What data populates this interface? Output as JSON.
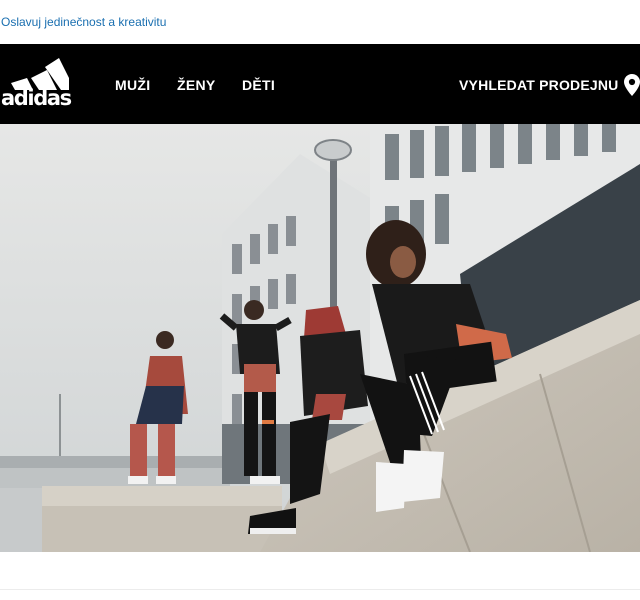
{
  "tagline": {
    "text": "Oslavuj jedinečnost a kreativitu"
  },
  "header": {
    "logo": {
      "icon": "adidas-performance-logo-icon",
      "wordmark": "adidas"
    },
    "nav": [
      {
        "label": "MUŽI"
      },
      {
        "label": "ŽENY"
      },
      {
        "label": "DĚTI"
      }
    ],
    "store_finder": {
      "label": "VYHLEDAT PRODEJNU",
      "icon": "location-pin-icon"
    }
  },
  "hero": {
    "image": "five-models-in-adidas-sportswear-on-concrete-ledge-photo"
  },
  "colors": {
    "header_background": "#000000",
    "header_text": "#ffffff",
    "tagline_link": "#1a6fb0",
    "page_background": "#ffffff"
  }
}
